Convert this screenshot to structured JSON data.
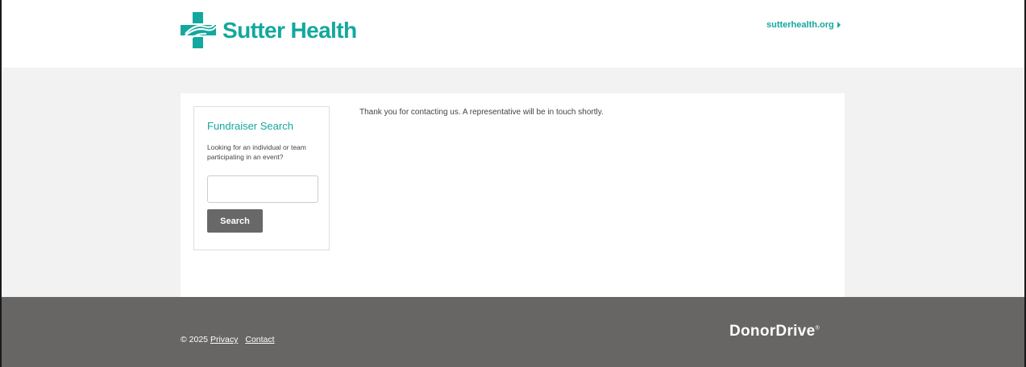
{
  "header": {
    "brand_name": "Sutter Health",
    "brand_color": "#13a89e",
    "site_link_label": "sutterhealth.org",
    "site_link_icon": "caret-right-icon"
  },
  "search_widget": {
    "title": "Fundraiser Search",
    "description": "Looking for an individual or team participating in an event?",
    "input_value": "",
    "input_placeholder": "",
    "button_label": "Search",
    "button_color": "#686868"
  },
  "main": {
    "message": "Thank you for contacting us.  A representative will be in touch shortly."
  },
  "footer": {
    "copyright": "© 2025",
    "privacy_label": "Privacy",
    "contact_label": "Contact",
    "powered_by_logo": "DonorDrive",
    "background_color": "#676664"
  }
}
